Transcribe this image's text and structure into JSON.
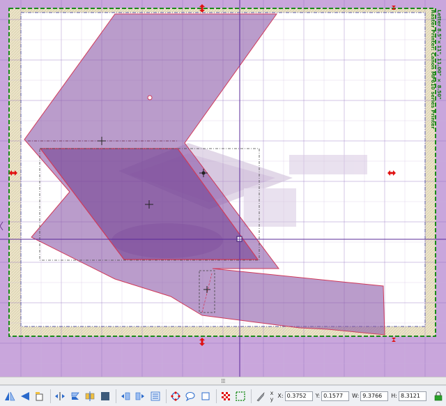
{
  "window": {
    "printer_label_line1": "Letter 8.5\"×11\", 11.00\" × 8.50\"",
    "printer_label_line2": "Raster Printer: Canon MP610 series Printer"
  },
  "colors": {
    "workspace_bg": "#c9a6dc",
    "page_bg": "#ffffff",
    "margin_bg": "#ece4c8",
    "page_border": "#1a8a1a",
    "grid_line": "#c9b6df",
    "grid_major": "#8f6fc0",
    "shape_fill": "#8c5aa8",
    "shape_stroke": "#d03a5a",
    "handle_red": "#e01010"
  },
  "toolbar": {
    "buttons": [
      {
        "name": "flip-horizontal-icon"
      },
      {
        "name": "flip-vertical-icon"
      },
      {
        "name": "rotate-icon"
      },
      {
        "name": "mirror-h-icon"
      },
      {
        "name": "mirror-v-icon"
      },
      {
        "name": "align-center-icon"
      },
      {
        "name": "fill-icon"
      },
      {
        "name": "group-icon"
      },
      {
        "name": "ungroup-icon"
      },
      {
        "name": "weld-icon"
      },
      {
        "name": "node-edit-icon"
      },
      {
        "name": "speech-icon"
      },
      {
        "name": "shape-square-icon"
      },
      {
        "name": "pattern-fill-icon"
      },
      {
        "name": "select-points-icon"
      },
      {
        "name": "knife-icon"
      }
    ],
    "xy_top": "x",
    "xy_bottom": "y",
    "x_label": "X:",
    "x_value": "0.3752",
    "y_label": "Y:",
    "y_value": "0.1577",
    "w_label": "W:",
    "w_value": "9.3766",
    "h_label": "H:",
    "h_value": "8.3121"
  }
}
